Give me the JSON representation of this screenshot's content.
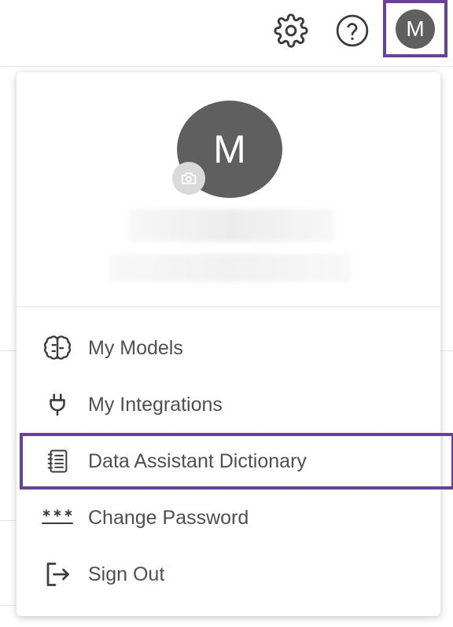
{
  "header": {
    "settings_icon": "gear-icon",
    "help_icon": "question-icon",
    "avatar_initial": "M"
  },
  "profile": {
    "avatar_initial": "M",
    "camera_icon": "camera-icon"
  },
  "menu": {
    "items": [
      {
        "label": "My Models",
        "icon": "brain-icon"
      },
      {
        "label": "My Integrations",
        "icon": "plug-icon"
      },
      {
        "label": "Data Assistant Dictionary",
        "icon": "dictionary-icon"
      },
      {
        "label": "Change Password",
        "icon": "password-icon"
      },
      {
        "label": "Sign Out",
        "icon": "sign-out-icon"
      }
    ]
  },
  "colors": {
    "highlight": "#6b3fa0",
    "avatar": "#5f5f5f"
  }
}
